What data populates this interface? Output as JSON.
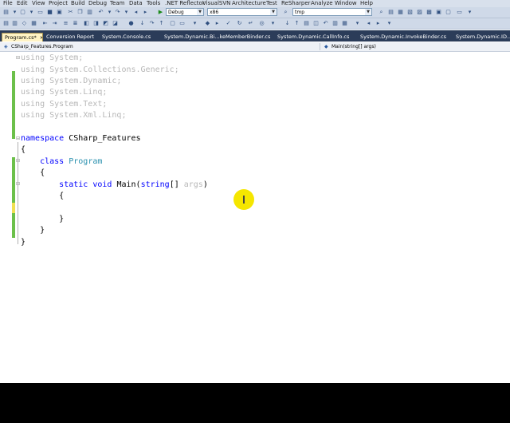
{
  "menu": [
    "File",
    "Edit",
    "View",
    "Project",
    "Build",
    "Debug",
    "Team",
    "Data",
    "Tools",
    ".NET Reflector",
    "VisualSVN",
    "Architecture",
    "Test",
    "ReSharper",
    "Analyze",
    "Window",
    "Help"
  ],
  "toolbar": {
    "config_value": "Debug",
    "platform_value": "x86",
    "find_value": "tmp"
  },
  "tabs": [
    {
      "label": "Program.cs*",
      "active": true
    },
    {
      "label": "Conversion Report",
      "active": false
    },
    {
      "label": "System.Console.cs",
      "active": false
    },
    {
      "label": "System.Dynamic.Bi...keMemberBinder.cs",
      "active": false
    },
    {
      "label": "System.Dynamic.CallInfo.cs",
      "active": false
    },
    {
      "label": "System.Dynamic.InvokeBinder.cs",
      "active": false
    },
    {
      "label": "System.Dynamic.ID...aO",
      "active": false
    }
  ],
  "nav": {
    "type_value": "CSharp_Features.Program",
    "member_value": "Main(string[] args)"
  },
  "code": {
    "using1": "System;",
    "using2": "System.Collections.Generic;",
    "using3": "System.Dynamic;",
    "using4": "System.Linq;",
    "using5": "System.Text;",
    "using6": "System.Xml.Linq;",
    "kw_using": "using",
    "kw_namespace": "namespace",
    "namespace_name": "CSharp_Features",
    "kw_class": "class",
    "class_name": "Program",
    "kw_static": "static",
    "kw_void": "void",
    "method_name": "Main(",
    "kw_string": "string",
    "param_rest": "[] ",
    "param_name": "args",
    "close_paren": ")",
    "brace_open": "{",
    "brace_close": "}"
  },
  "colors": {
    "keyword": "#0000ff",
    "type": "#2b91af",
    "unused": "#b7b7b7",
    "change_bar": "#6cc04a",
    "tab_strip": "#2b3c59",
    "active_tab": "#fff3c4",
    "cursor_highlight": "#f5e600"
  }
}
